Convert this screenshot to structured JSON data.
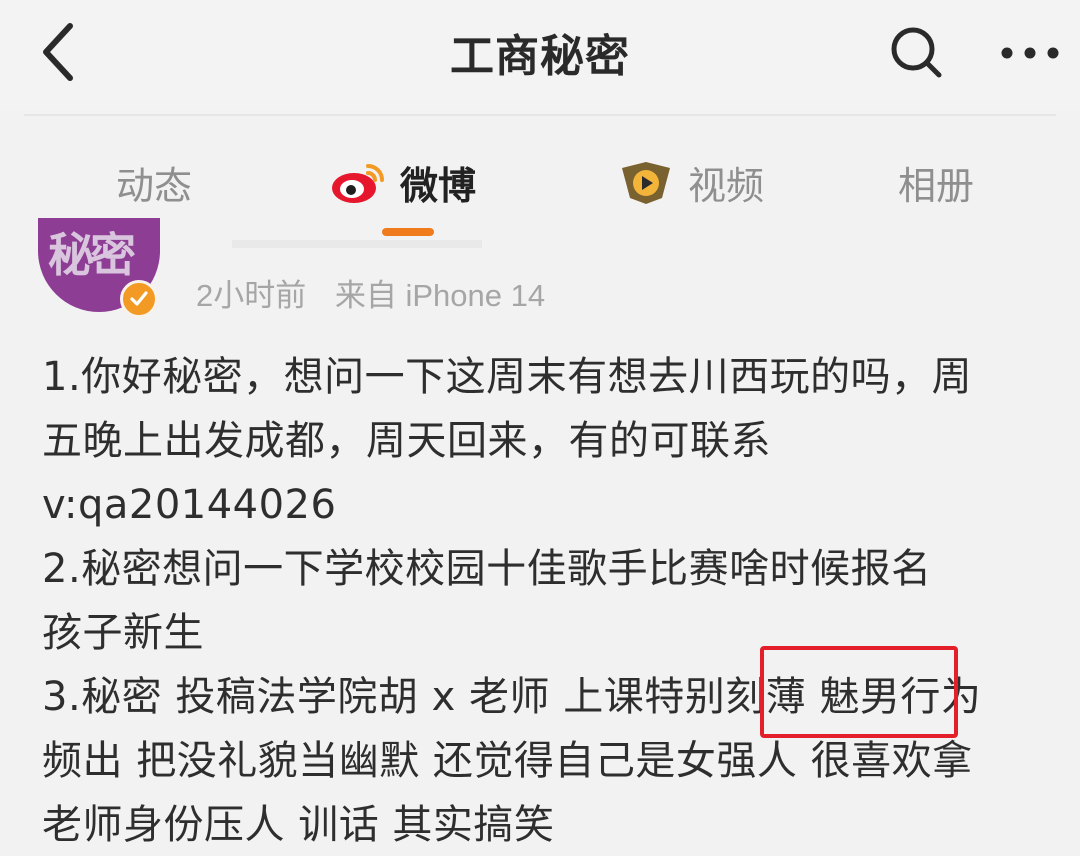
{
  "header": {
    "title": "工商秘密",
    "back_icon": "chevron-left-icon",
    "search_icon": "search-icon",
    "more_icon": "more-horizontal-icon"
  },
  "tabs": [
    {
      "label": "动态",
      "icon": null,
      "active": false
    },
    {
      "label": "微博",
      "icon": "weibo-logo-icon",
      "active": true
    },
    {
      "label": "视频",
      "icon": "video-play-icon",
      "active": false
    },
    {
      "label": "相册",
      "icon": null,
      "active": false
    }
  ],
  "post": {
    "avatar_text": "秘密",
    "time": "2小时前",
    "source": "来自 iPhone 14",
    "lines": [
      "1.你好秘密，想问一下这周末有想去川西玩的吗，周",
      "五晚上出发成都，周天回来，有的可联系",
      "v:qa20144026",
      "2.秘密想问一下学校校园十佳歌手比赛啥时候报名",
      "孩子新生",
      "3.秘密 投稿法学院胡 x 老师 上课特别刻薄 魅男行为",
      "频出 把没礼貌当幽默 还觉得自己是女强人 很喜欢拿",
      "老师身份压人 训话 其实搞笑"
    ]
  },
  "colors": {
    "accent": "#f07b1d",
    "highlight_border": "#e3202a",
    "avatar_bg": "#8e3d95",
    "badge": "#f39a24"
  }
}
